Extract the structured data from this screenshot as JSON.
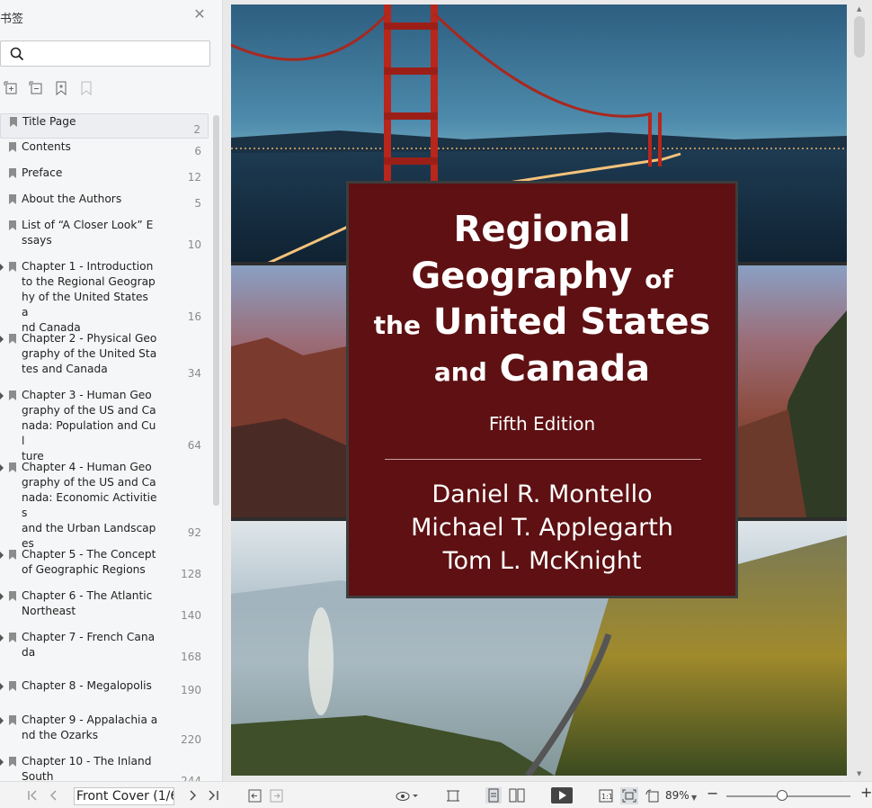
{
  "sidebar": {
    "title": "书签",
    "close_icon": "close-icon",
    "search_placeholder": "",
    "tools": [
      "expand-all-icon",
      "collapse-all-icon",
      "add-bookmark-icon",
      "remove-bookmark-icon"
    ],
    "bookmarks": [
      {
        "label": "Title Page",
        "page": "2",
        "has_children": false,
        "selected": true
      },
      {
        "label": "Contents",
        "page": "6",
        "has_children": false
      },
      {
        "label": "Preface",
        "page": "12",
        "has_children": false
      },
      {
        "label": "About the Authors",
        "page": "5",
        "has_children": false
      },
      {
        "label": "List of “A Closer Look” E\nssays",
        "page": "10",
        "has_children": false
      },
      {
        "label": "Chapter 1 - Introduction\nto the Regional Geograp\nhy of the United States a\nnd Canada",
        "page": "16",
        "has_children": true
      },
      {
        "label": "Chapter 2 - Physical Geo\ngraphy of the United Sta\ntes and Canada",
        "page": "34",
        "has_children": true
      },
      {
        "label": "Chapter 3 - Human Geo\ngraphy of the US and Ca\nnada: Population and Cul\nture",
        "page": "64",
        "has_children": true
      },
      {
        "label": "Chapter 4 - Human Geo\ngraphy of the US and Ca\nnada: Economic Activities\nand the Urban Landscap\nes",
        "page": "92",
        "has_children": true
      },
      {
        "label": "Chapter 5 - The Concept\nof Geographic Regions",
        "page": "128",
        "has_children": true
      },
      {
        "label": "Chapter 6 - The Atlantic\nNortheast",
        "page": "140",
        "has_children": true
      },
      {
        "label": "Chapter 7 - French Cana\nda",
        "page": "168",
        "has_children": true
      },
      {
        "label": "Chapter 8 - Megalopolis",
        "page": "190",
        "has_children": true
      },
      {
        "label": "Chapter 9 - Appalachia a\nnd the Ozarks",
        "page": "220",
        "has_children": true
      },
      {
        "label": "Chapter 10 - The Inland\nSouth",
        "page": "244",
        "has_children": true
      }
    ]
  },
  "cover": {
    "title_line1": "Regional",
    "title_line2a": "Geography",
    "title_line2b": "of",
    "title_line3a": "the",
    "title_line3b": "United States",
    "title_line4a": "and",
    "title_line4b": "Canada",
    "edition": "Fifth Edition",
    "authors": [
      "Daniel R. Montello",
      "Michael T. Applegarth",
      "Tom L. McKnight"
    ],
    "box_color": "#5e1012"
  },
  "statusbar": {
    "page_field": "Front Cover (1/6",
    "zoom": "89%",
    "zoom_fraction": 0.45
  }
}
